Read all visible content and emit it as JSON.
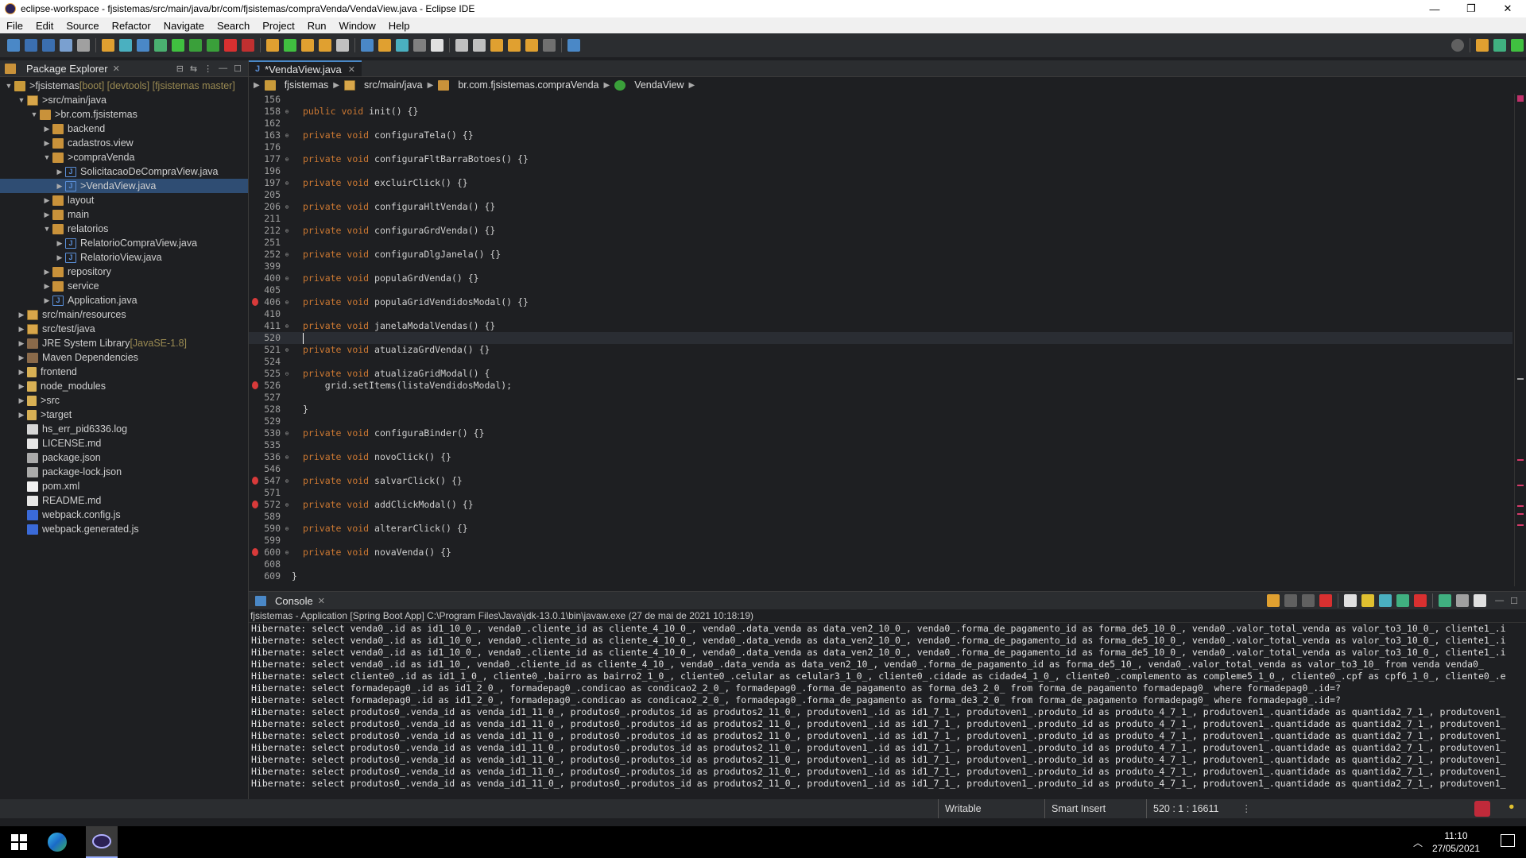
{
  "window": {
    "title": "eclipse-workspace - fjsistemas/src/main/java/br/com/fjsistemas/compraVenda/VendaView.java - Eclipse IDE",
    "controls": [
      "—",
      "❐",
      "✕"
    ]
  },
  "menu": [
    "File",
    "Edit",
    "Source",
    "Refactor",
    "Navigate",
    "Search",
    "Project",
    "Run",
    "Window",
    "Help"
  ],
  "package_explorer": {
    "title": "Package Explorer",
    "tree": [
      {
        "label": "fjsistemas",
        "deco": " [boot] [devtools] [fjsistemas master]",
        "prefix": "> ",
        "icon": "proj",
        "depth": 0,
        "tw": "v"
      },
      {
        "label": "src/main/java",
        "prefix": "> ",
        "icon": "srcf",
        "depth": 1,
        "tw": "v"
      },
      {
        "label": "br.com.fjsistemas",
        "prefix": "> ",
        "icon": "pkg",
        "depth": 2,
        "tw": "v"
      },
      {
        "label": "backend",
        "icon": "pkg",
        "depth": 3,
        "tw": ">"
      },
      {
        "label": "cadastros.view",
        "icon": "pkg",
        "depth": 3,
        "tw": ">"
      },
      {
        "label": "compraVenda",
        "prefix": "> ",
        "icon": "pkg",
        "depth": 3,
        "tw": "v"
      },
      {
        "label": "SolicitacaoDeCompraView.java",
        "icon": "java",
        "depth": 4,
        "tw": ">"
      },
      {
        "label": "VendaView.java",
        "prefix": "> ",
        "icon": "java",
        "depth": 4,
        "tw": ">",
        "selected": true
      },
      {
        "label": "layout",
        "icon": "pkg",
        "depth": 3,
        "tw": ">"
      },
      {
        "label": "main",
        "icon": "pkg",
        "depth": 3,
        "tw": ">"
      },
      {
        "label": "relatorios",
        "icon": "pkg",
        "depth": 3,
        "tw": "v"
      },
      {
        "label": "RelatorioCompraView.java",
        "icon": "java",
        "depth": 4,
        "tw": ">"
      },
      {
        "label": "RelatorioView.java",
        "icon": "java",
        "depth": 4,
        "tw": ">"
      },
      {
        "label": "repository",
        "icon": "pkg",
        "depth": 3,
        "tw": ">"
      },
      {
        "label": "service",
        "icon": "pkg",
        "depth": 3,
        "tw": ">"
      },
      {
        "label": "Application.java",
        "icon": "java",
        "depth": 3,
        "tw": ">"
      },
      {
        "label": "src/main/resources",
        "icon": "srcf",
        "depth": 1,
        "tw": ">"
      },
      {
        "label": "src/test/java",
        "icon": "srcf",
        "depth": 1,
        "tw": ">"
      },
      {
        "label": "JRE System Library",
        "deco": " [JavaSE-1.8]",
        "icon": "lib",
        "depth": 1,
        "tw": ">"
      },
      {
        "label": "Maven Dependencies",
        "icon": "lib",
        "depth": 1,
        "tw": ">"
      },
      {
        "label": "frontend",
        "icon": "fold",
        "depth": 1,
        "tw": ">"
      },
      {
        "label": "node_modules",
        "icon": "fold",
        "depth": 1,
        "tw": ">"
      },
      {
        "label": "src",
        "prefix": "> ",
        "icon": "fold",
        "depth": 1,
        "tw": ">"
      },
      {
        "label": "target",
        "prefix": "> ",
        "icon": "fold",
        "depth": 1,
        "tw": ">"
      },
      {
        "label": "hs_err_pid6336.log",
        "icon": "file",
        "depth": 1,
        "tw": ""
      },
      {
        "label": "LICENSE.md",
        "icon": "md",
        "depth": 1,
        "tw": ""
      },
      {
        "label": "package.json",
        "icon": "json",
        "depth": 1,
        "tw": ""
      },
      {
        "label": "package-lock.json",
        "icon": "json",
        "depth": 1,
        "tw": ""
      },
      {
        "label": "pom.xml",
        "icon": "xml",
        "depth": 1,
        "tw": ""
      },
      {
        "label": "README.md",
        "icon": "md",
        "depth": 1,
        "tw": ""
      },
      {
        "label": "webpack.config.js",
        "icon": "js",
        "depth": 1,
        "tw": ""
      },
      {
        "label": "webpack.generated.js",
        "icon": "js",
        "depth": 1,
        "tw": ""
      }
    ]
  },
  "editor": {
    "tab_label": "*VendaView.java",
    "breadcrumb": [
      "fjsistemas",
      "src/main/java",
      "br.com.fjsistemas.compraVenda",
      "VendaView"
    ],
    "lines": [
      {
        "n": "156",
        "fold": "",
        "code": "",
        "bp": false
      },
      {
        "n": "158",
        "fold": "⊕",
        "code": "public void init() {}",
        "bp": false
      },
      {
        "n": "162",
        "fold": "",
        "code": "",
        "bp": false
      },
      {
        "n": "163",
        "fold": "⊕",
        "code": "private void configuraTela() {}",
        "bp": false
      },
      {
        "n": "176",
        "fold": "",
        "code": "",
        "bp": false
      },
      {
        "n": "177",
        "fold": "⊕",
        "code": "private void configuraFltBarraBotoes() {}",
        "bp": false
      },
      {
        "n": "196",
        "fold": "",
        "code": "",
        "bp": false
      },
      {
        "n": "197",
        "fold": "⊕",
        "code": "private void excluirClick() {}",
        "bp": false
      },
      {
        "n": "205",
        "fold": "",
        "code": "",
        "bp": false
      },
      {
        "n": "206",
        "fold": "⊕",
        "code": "private void configuraHltVenda() {}",
        "bp": false
      },
      {
        "n": "211",
        "fold": "",
        "code": "",
        "bp": false
      },
      {
        "n": "212",
        "fold": "⊕",
        "code": "private void configuraGrdVenda() {}",
        "bp": false
      },
      {
        "n": "251",
        "fold": "",
        "code": "",
        "bp": false
      },
      {
        "n": "252",
        "fold": "⊕",
        "code": "private void configuraDlgJanela() {}",
        "bp": false
      },
      {
        "n": "399",
        "fold": "",
        "code": "",
        "bp": false
      },
      {
        "n": "400",
        "fold": "⊕",
        "code": "private void populaGrdVenda() {}",
        "bp": false
      },
      {
        "n": "405",
        "fold": "",
        "code": "",
        "bp": false
      },
      {
        "n": "406",
        "fold": "⊕",
        "code": "private void populaGridVendidosModal() {}",
        "bp": true
      },
      {
        "n": "410",
        "fold": "",
        "code": "",
        "bp": false
      },
      {
        "n": "411",
        "fold": "⊕",
        "code": "private void janelaModalVendas() {}",
        "bp": false
      },
      {
        "n": "520",
        "fold": "",
        "code": "",
        "bp": false,
        "current": true
      },
      {
        "n": "521",
        "fold": "⊕",
        "code": "private void atualizaGrdVenda() {}",
        "bp": false
      },
      {
        "n": "524",
        "fold": "",
        "code": "",
        "bp": false
      },
      {
        "n": "525",
        "fold": "⊖",
        "code": "private void atualizaGridModal() {",
        "bp": false
      },
      {
        "n": "526",
        "fold": "",
        "code": "    grid.setItems(listaVendidosModal);",
        "bp": true
      },
      {
        "n": "527",
        "fold": "",
        "code": "",
        "bp": false
      },
      {
        "n": "528",
        "fold": "",
        "code": "}",
        "bp": false
      },
      {
        "n": "529",
        "fold": "",
        "code": "",
        "bp": false
      },
      {
        "n": "530",
        "fold": "⊕",
        "code": "private void configuraBinder() {}",
        "bp": false
      },
      {
        "n": "535",
        "fold": "",
        "code": "",
        "bp": false
      },
      {
        "n": "536",
        "fold": "⊕",
        "code": "private void novoClick() {}",
        "bp": false
      },
      {
        "n": "546",
        "fold": "",
        "code": "",
        "bp": false
      },
      {
        "n": "547",
        "fold": "⊕",
        "code": "private void salvarClick() {}",
        "bp": true
      },
      {
        "n": "571",
        "fold": "",
        "code": "",
        "bp": false
      },
      {
        "n": "572",
        "fold": "⊕",
        "code": "private void addClickModal() {}",
        "bp": true
      },
      {
        "n": "589",
        "fold": "",
        "code": "",
        "bp": false
      },
      {
        "n": "590",
        "fold": "⊕",
        "code": "private void alterarClick() {}",
        "bp": false
      },
      {
        "n": "599",
        "fold": "",
        "code": "",
        "bp": false
      },
      {
        "n": "600",
        "fold": "⊕",
        "code": "private void novaVenda() {}",
        "bp": true
      },
      {
        "n": "608",
        "fold": "",
        "code": "",
        "bp": false
      },
      {
        "n": "609",
        "fold": "",
        "code": "}",
        "bp": false,
        "top": true
      }
    ]
  },
  "console": {
    "title": "Console",
    "description": "fjsistemas - Application [Spring Boot App] C:\\Program Files\\Java\\jdk-13.0.1\\bin\\javaw.exe  (27 de mai de 2021 10:18:19)",
    "lines": [
      "Hibernate: select venda0_.id as id1_10_0_, venda0_.cliente_id as cliente_4_10_0_, venda0_.data_venda as data_ven2_10_0_, venda0_.forma_de_pagamento_id as forma_de5_10_0_, venda0_.valor_total_venda as valor_to3_10_0_, cliente1_.i",
      "Hibernate: select venda0_.id as id1_10_0_, venda0_.cliente_id as cliente_4_10_0_, venda0_.data_venda as data_ven2_10_0_, venda0_.forma_de_pagamento_id as forma_de5_10_0_, venda0_.valor_total_venda as valor_to3_10_0_, cliente1_.i",
      "Hibernate: select venda0_.id as id1_10_0_, venda0_.cliente_id as cliente_4_10_0_, venda0_.data_venda as data_ven2_10_0_, venda0_.forma_de_pagamento_id as forma_de5_10_0_, venda0_.valor_total_venda as valor_to3_10_0_, cliente1_.i",
      "Hibernate: select venda0_.id as id1_10_, venda0_.cliente_id as cliente_4_10_, venda0_.data_venda as data_ven2_10_, venda0_.forma_de_pagamento_id as forma_de5_10_, venda0_.valor_total_venda as valor_to3_10_ from venda venda0_",
      "Hibernate: select cliente0_.id as id1_1_0_, cliente0_.bairro as bairro2_1_0_, cliente0_.celular as celular3_1_0_, cliente0_.cidade as cidade4_1_0_, cliente0_.complemento as compleme5_1_0_, cliente0_.cpf as cpf6_1_0_, cliente0_.e",
      "Hibernate: select formadepag0_.id as id1_2_0_, formadepag0_.condicao as condicao2_2_0_, formadepag0_.forma_de_pagamento as forma_de3_2_0_ from forma_de_pagamento formadepag0_ where formadepag0_.id=?",
      "Hibernate: select formadepag0_.id as id1_2_0_, formadepag0_.condicao as condicao2_2_0_, formadepag0_.forma_de_pagamento as forma_de3_2_0_ from forma_de_pagamento formadepag0_ where formadepag0_.id=?",
      "Hibernate: select produtos0_.venda_id as venda_id1_11_0_, produtos0_.produtos_id as produtos2_11_0_, produtoven1_.id as id1_7_1_, produtoven1_.produto_id as produto_4_7_1_, produtoven1_.quantidade as quantida2_7_1_, produtoven1_",
      "Hibernate: select produtos0_.venda_id as venda_id1_11_0_, produtos0_.produtos_id as produtos2_11_0_, produtoven1_.id as id1_7_1_, produtoven1_.produto_id as produto_4_7_1_, produtoven1_.quantidade as quantida2_7_1_, produtoven1_",
      "Hibernate: select produtos0_.venda_id as venda_id1_11_0_, produtos0_.produtos_id as produtos2_11_0_, produtoven1_.id as id1_7_1_, produtoven1_.produto_id as produto_4_7_1_, produtoven1_.quantidade as quantida2_7_1_, produtoven1_",
      "Hibernate: select produtos0_.venda_id as venda_id1_11_0_, produtos0_.produtos_id as produtos2_11_0_, produtoven1_.id as id1_7_1_, produtoven1_.produto_id as produto_4_7_1_, produtoven1_.quantidade as quantida2_7_1_, produtoven1_",
      "Hibernate: select produtos0_.venda_id as venda_id1_11_0_, produtos0_.produtos_id as produtos2_11_0_, produtoven1_.id as id1_7_1_, produtoven1_.produto_id as produto_4_7_1_, produtoven1_.quantidade as quantida2_7_1_, produtoven1_",
      "Hibernate: select produtos0_.venda_id as venda_id1_11_0_, produtos0_.produtos_id as produtos2_11_0_, produtoven1_.id as id1_7_1_, produtoven1_.produto_id as produto_4_7_1_, produtoven1_.quantidade as quantida2_7_1_, produtoven1_",
      "Hibernate: select produtos0_.venda_id as venda_id1_11_0_, produtos0_.produtos_id as produtos2_11_0_, produtoven1_.id as id1_7_1_, produtoven1_.produto_id as produto_4_7_1_, produtoven1_.quantidade as quantida2_7_1_, produtoven1_"
    ]
  },
  "status": {
    "writable": "Writable",
    "insert_mode": "Smart Insert",
    "position": "520 : 1 : 16611"
  },
  "taskbar": {
    "time": "11:10",
    "date": "27/05/2021"
  },
  "colors": {
    "keyword": "#cc7832",
    "breakpoint": "#d83a3a",
    "selection": "#2f4d73"
  }
}
